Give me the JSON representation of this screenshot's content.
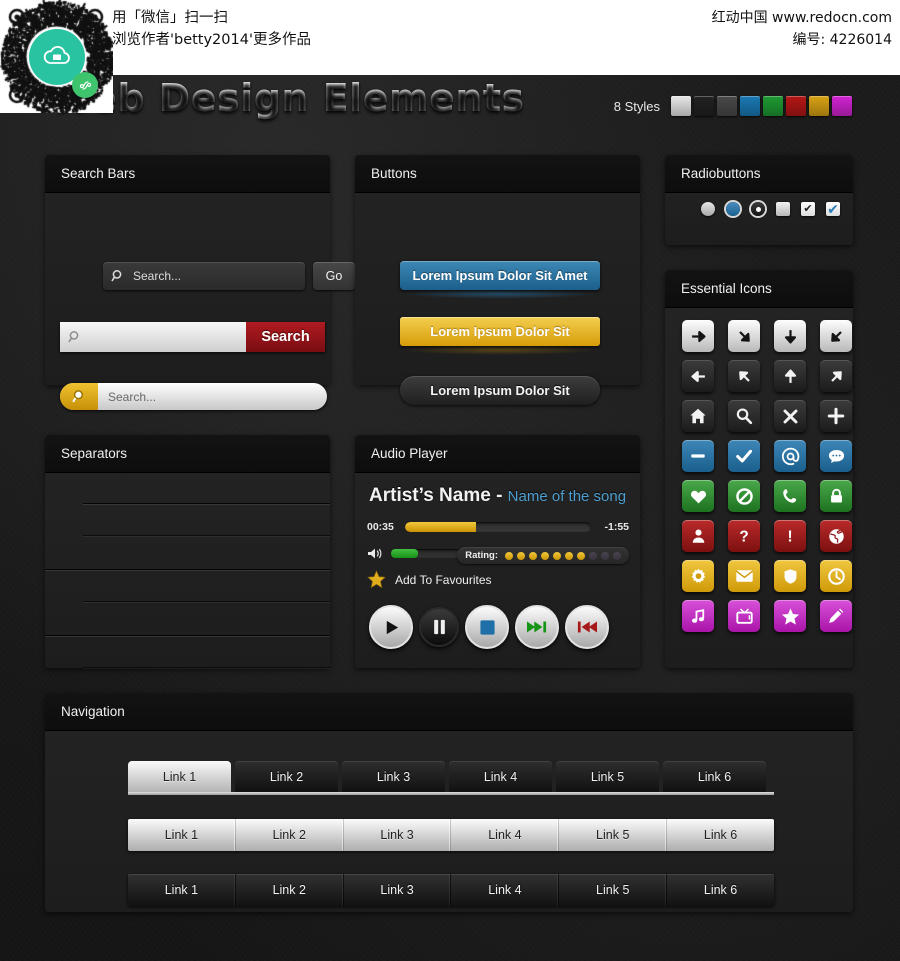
{
  "watermark": {
    "line1": "用「微信」扫一扫",
    "line2": "浏览作者'betty2014'更多作品",
    "site": "红动中国 www.redocn.com",
    "code": "编号: 4226014"
  },
  "header": {
    "title": "Web Design Elements",
    "styles_label": "8 Styles",
    "swatches": [
      {
        "name": "white",
        "color": "#e8e8e8"
      },
      {
        "name": "black",
        "color": "#222222"
      },
      {
        "name": "gray",
        "color": "#4a4a4a"
      },
      {
        "name": "blue",
        "color": "#1a7ab5"
      },
      {
        "name": "green",
        "color": "#1e9a33"
      },
      {
        "name": "red",
        "color": "#b41616"
      },
      {
        "name": "gold",
        "color": "#d8a314"
      },
      {
        "name": "magenta",
        "color": "#d224d2"
      }
    ]
  },
  "search_bars": {
    "title": "Search Bars",
    "bar1": {
      "placeholder": "Search...",
      "button": "Go"
    },
    "bar2": {
      "placeholder": "",
      "button": "Search"
    },
    "bar3": {
      "placeholder": "Search..."
    }
  },
  "buttons": {
    "title": "Buttons",
    "items": [
      {
        "label": "Lorem Ipsum Dolor Sit Amet",
        "style": "blue"
      },
      {
        "label": "Lorem Ipsum Dolor Sit",
        "style": "gold"
      },
      {
        "label": "Lorem Ipsum Dolor Sit",
        "style": "dark"
      }
    ]
  },
  "radiobuttons": {
    "title": "Radiobuttons",
    "controls": [
      {
        "name": "radio-unselected",
        "state": "off"
      },
      {
        "name": "radio-selected-blue",
        "state": "on"
      },
      {
        "name": "radio-selected-dot",
        "state": "on"
      },
      {
        "name": "checkbox-unchecked",
        "state": "off"
      },
      {
        "name": "checkbox-checked-dark",
        "state": "on",
        "glyph": "✔"
      },
      {
        "name": "checkbox-checked-blue",
        "state": "on",
        "glyph": "✔"
      }
    ]
  },
  "essential_icons": {
    "title": "Essential Icons",
    "icons": [
      {
        "name": "arrow-right-icon",
        "style": "white"
      },
      {
        "name": "arrow-down-right-icon",
        "style": "white"
      },
      {
        "name": "arrow-down-icon",
        "style": "white"
      },
      {
        "name": "arrow-down-left-icon",
        "style": "white"
      },
      {
        "name": "arrow-left-icon",
        "style": "dark"
      },
      {
        "name": "arrow-up-left-icon",
        "style": "dark"
      },
      {
        "name": "arrow-up-icon",
        "style": "dark"
      },
      {
        "name": "arrow-up-right-icon",
        "style": "dark"
      },
      {
        "name": "home-icon",
        "style": "dark"
      },
      {
        "name": "search-icon",
        "style": "dark"
      },
      {
        "name": "close-icon",
        "style": "dark"
      },
      {
        "name": "plus-icon",
        "style": "dark"
      },
      {
        "name": "minus-icon",
        "style": "blue"
      },
      {
        "name": "check-icon",
        "style": "blue"
      },
      {
        "name": "at-icon",
        "style": "blue"
      },
      {
        "name": "comment-icon",
        "style": "blue"
      },
      {
        "name": "heart-icon",
        "style": "green"
      },
      {
        "name": "no-entry-icon",
        "style": "green"
      },
      {
        "name": "phone-icon",
        "style": "green"
      },
      {
        "name": "lock-icon",
        "style": "green"
      },
      {
        "name": "user-icon",
        "style": "red"
      },
      {
        "name": "question-icon",
        "style": "red"
      },
      {
        "name": "exclamation-icon",
        "style": "red"
      },
      {
        "name": "globe-icon",
        "style": "red"
      },
      {
        "name": "gear-icon",
        "style": "gold"
      },
      {
        "name": "envelope-icon",
        "style": "gold"
      },
      {
        "name": "shield-icon",
        "style": "gold"
      },
      {
        "name": "clock-icon",
        "style": "gold"
      },
      {
        "name": "music-note-icon",
        "style": "mag"
      },
      {
        "name": "tv-icon",
        "style": "mag"
      },
      {
        "name": "star-icon",
        "style": "mag"
      },
      {
        "name": "pencil-icon",
        "style": "mag"
      }
    ]
  },
  "separators": {
    "title": "Separators",
    "lines": [
      {
        "width": "inset",
        "weight": "hair"
      },
      {
        "width": "inset",
        "weight": "soft"
      },
      {
        "width": "full",
        "weight": "hair"
      },
      {
        "width": "inset",
        "weight": "soft"
      },
      {
        "width": "full",
        "weight": "hair"
      },
      {
        "width": "inset",
        "weight": "soft"
      }
    ]
  },
  "audio_player": {
    "title": "Audio Player",
    "artist": "Artist’s Name - ",
    "song": "Name of the song",
    "time_elapsed": "00:35",
    "time_remaining": "-1:55",
    "progress_percent": 38,
    "volume_percent": 25,
    "rating_label": "Rating:",
    "rating_filled": 7,
    "rating_total": 10,
    "favourites_label": "Add To Favourites",
    "controls": [
      {
        "name": "play-button",
        "style": "light"
      },
      {
        "name": "pause-button",
        "style": "dark"
      },
      {
        "name": "stop-button",
        "style": "light"
      },
      {
        "name": "forward-button",
        "style": "light"
      },
      {
        "name": "rewind-button",
        "style": "light"
      }
    ]
  },
  "navigation": {
    "title": "Navigation",
    "tabs": [
      {
        "label": "Link 1",
        "active": true
      },
      {
        "label": "Link 2",
        "active": false
      },
      {
        "label": "Link 3",
        "active": false
      },
      {
        "label": "Link 4",
        "active": false
      },
      {
        "label": "Link 5",
        "active": false
      },
      {
        "label": "Link 6",
        "active": false
      }
    ],
    "bar_light": [
      "Link 1",
      "Link 2",
      "Link 3",
      "Link 4",
      "Link 5",
      "Link 6"
    ],
    "bar_dark": [
      "Link 1",
      "Link 2",
      "Link 3",
      "Link 4",
      "Link 5",
      "Link 6"
    ]
  }
}
